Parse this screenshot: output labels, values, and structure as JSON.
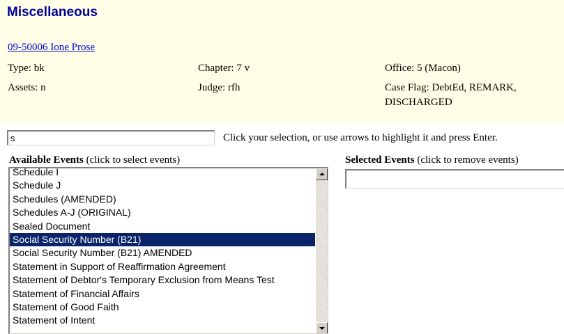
{
  "page": {
    "title": "Miscellaneous"
  },
  "case": {
    "link": "09-50006 Ione Prose",
    "type": "Type: bk",
    "chapter": "Chapter: 7 v",
    "office": "Office: 5 (Macon)",
    "assets": "Assets: n",
    "judge": "Judge: rfh",
    "case_flag": "Case Flag: DebtEd, REMARK, DISCHARGED"
  },
  "search": {
    "value": "s",
    "instruction": "Click your selection, or use arrows to highlight it and press Enter."
  },
  "available_events": {
    "heading": "Available Events",
    "hint": " (click to select events)",
    "selected_index": 5,
    "items": [
      "Schedule I",
      "Schedule J",
      "Schedules (AMENDED)",
      "Schedules A-J (ORIGINAL)",
      "Sealed Document",
      "Social Security Number (B21)",
      "Social Security Number (B21) AMENDED",
      "Statement in Support of Reaffirmation Agreement",
      "Statement of Debtor's Temporary Exclusion from Means Test",
      "Statement of Financial Affairs",
      "Statement of Good Faith",
      "Statement of Intent"
    ]
  },
  "selected_events": {
    "heading": "Selected Events",
    "hint": " (click to remove events)",
    "items": []
  },
  "colors": {
    "title": "#000099",
    "link": "#0000CC",
    "header_background": "#FFFFE8",
    "selection_background": "#0A246A",
    "selection_text": "#FFFFFF"
  },
  "icons": {
    "scroll_up": "triangle-up-icon",
    "scroll_down": "triangle-down-icon"
  }
}
